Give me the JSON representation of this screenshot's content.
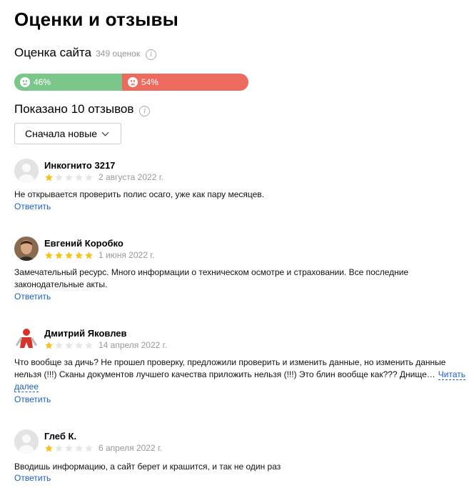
{
  "page": {
    "title": "Оценки и отзывы"
  },
  "rating": {
    "label": "Оценка сайта",
    "count": "349 оценок",
    "positive_pct": "46%",
    "negative_pct": "54%",
    "positive_fraction": 0.46,
    "positive_color": "#7ac68b",
    "negative_color": "#ec6a5e"
  },
  "reviews_header": {
    "shown_label": "Показано 10 отзывов",
    "sort_selected": "Сначала новые"
  },
  "reviews": [
    {
      "author": "Инкогнито 3217",
      "rating": 1,
      "date": "2 августа 2022 г.",
      "text": "Не открывается проверить полис осаго, уже как пару месяцев.",
      "reply": "Ответить",
      "avatar": "default-avatar-icon"
    },
    {
      "author": "Евгений Коробко",
      "rating": 5,
      "date": "1 июня 2022 г.",
      "text": "Замечательный ресурс. Много информации о техническом осмотре и страховании. Все последние законодательные акты.",
      "reply": "Ответить",
      "avatar": "user-photo"
    },
    {
      "author": "Дмитрий Яковлев",
      "rating": 1,
      "date": "14 апреля 2022 г.",
      "text": "Что вообще за дичь? Не прошел проверку, предложили проверить и изменить данные, но изменить данные нельзя (!!!) Сканы документов лучшего качества приложить нельзя (!!!) Это блин вообще как??? Днище…",
      "read_more": "Читать далее",
      "reply": "Ответить",
      "avatar": "red-figure-avatar"
    },
    {
      "author": "Глеб К.",
      "rating": 1,
      "date": "6 апреля 2022 г.",
      "text": "Вводишь информацию, а сайт берет и крашится, и так не один раз",
      "reply": "Ответить",
      "avatar": "default-avatar-icon"
    }
  ]
}
